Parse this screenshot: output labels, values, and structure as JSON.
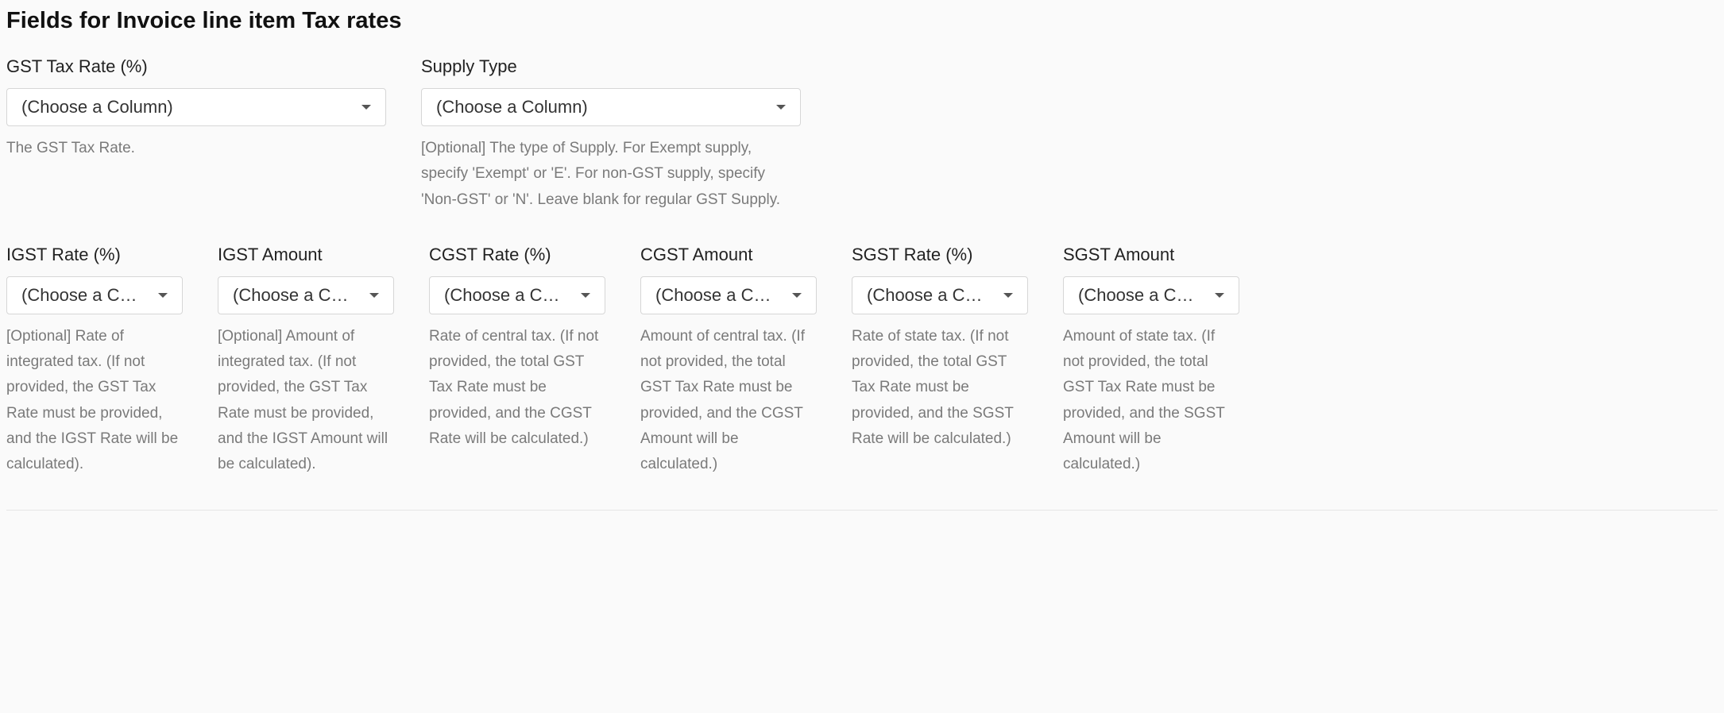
{
  "section_title": "Fields for Invoice line item Tax rates",
  "placeholder_full": "(Choose a Column)",
  "placeholder_short": "(Choose a C…",
  "row1": [
    {
      "label": "GST Tax Rate (%)",
      "help": "The GST Tax Rate."
    },
    {
      "label": "Supply Type",
      "help": "[Optional] The type of Supply. For Exempt supply, specify 'Exempt' or 'E'. For non-GST supply, specify 'Non-GST' or 'N'. Leave blank for regular GST Supply."
    }
  ],
  "row2": [
    {
      "label": "IGST Rate (%)",
      "help": "[Optional] Rate of integrated tax. (If not provided, the GST Tax Rate must be provided, and the IGST Rate will be calculated)."
    },
    {
      "label": "IGST Amount",
      "help": "[Optional] Amount of integrated tax. (If not provided, the GST Tax Rate must be provided, and the IGST Amount will be calculated)."
    },
    {
      "label": "CGST Rate (%)",
      "help": "Rate of central tax. (If not provided, the total GST Tax Rate must be provided, and the CGST Rate will be calculated.)"
    },
    {
      "label": "CGST Amount",
      "help": "Amount of central tax. (If not provided, the total GST Tax Rate must be provided, and the CGST Amount will be calculated.)"
    },
    {
      "label": "SGST Rate (%)",
      "help": "Rate of state tax. (If not provided, the total GST Tax Rate must be provided, and the SGST Rate will be calculated.)"
    },
    {
      "label": "SGST Amount",
      "help": "Amount of state tax. (If not provided, the total GST Tax Rate must be provided, and the SGST Amount will be calculated.)"
    }
  ]
}
